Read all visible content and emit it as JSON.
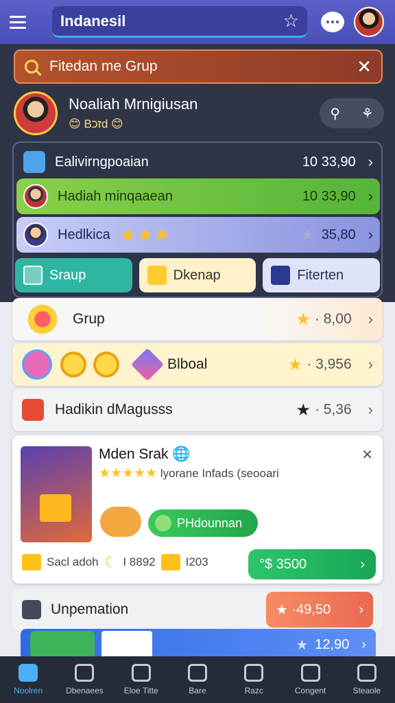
{
  "topbar": {
    "title": "Indanesil",
    "star_icon": "star-outline-icon",
    "chat_icon": "chat-icon"
  },
  "search": {
    "value": "Fitedan me Grup"
  },
  "profile": {
    "name": "Noaliah Mrnigiusan",
    "subtitle": "😊 Bזכd 😊"
  },
  "rows": [
    {
      "label": "Ealivirngpoaian",
      "value": "10  33,90"
    },
    {
      "label": "Hadiah minqaaean",
      "value": "10  33,90"
    },
    {
      "label": "Hedlkica",
      "value": "35,80"
    }
  ],
  "chips": [
    {
      "label": "Sraup"
    },
    {
      "label": "Dkenap"
    },
    {
      "label": "Fiterten"
    }
  ],
  "list": [
    {
      "label": "Grup",
      "value": "· 8,00"
    },
    {
      "label": "Blboal",
      "value": "· 3,956"
    },
    {
      "label": "Hadikin dMagusss",
      "value": "· 5,36"
    }
  ],
  "promo": {
    "title": "Mden Srak",
    "rating_text": "lyorane Infads (seooari",
    "button": "PHdounnan",
    "meta1": "Sacl adoh",
    "meta2": "I 8892",
    "meta3": "I203",
    "big_value": "3500"
  },
  "update": {
    "label": "Unpemation",
    "value": "·49,50"
  },
  "bluebar": {
    "value": "12,90"
  },
  "nav": [
    {
      "label": "Noolren"
    },
    {
      "label": "Dbenaees"
    },
    {
      "label": "Eloe Titte"
    },
    {
      "label": "Bare"
    },
    {
      "label": "Razc"
    },
    {
      "label": "Congent"
    },
    {
      "label": "Steaole"
    }
  ],
  "colors": {
    "topbar": "#4a4fb8",
    "accent_green": "#55b43a",
    "accent_orange": "#e86a52"
  }
}
